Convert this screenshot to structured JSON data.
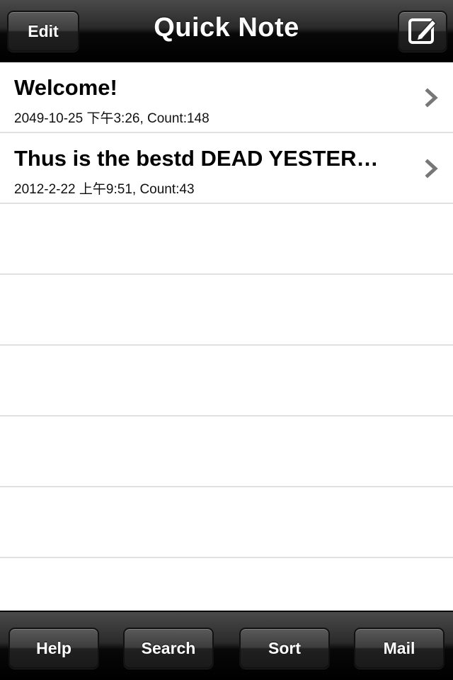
{
  "navbar": {
    "title": "Quick Note",
    "edit_label": "Edit",
    "compose_icon": "compose-icon"
  },
  "notes": [
    {
      "title": "Welcome!",
      "subtitle": "2049-10-25 下午3:26, Count:148"
    },
    {
      "title": "Thus is the  bestd DEAD YESTER…",
      "subtitle": "2012-2-22 上午9:51, Count:43"
    }
  ],
  "toolbar": {
    "help_label": "Help",
    "search_label": "Search",
    "sort_label": "Sort",
    "mail_label": "Mail"
  },
  "colors": {
    "bar_dark": "#000000",
    "row_separator": "#e0e0e0",
    "chevron": "#777777"
  }
}
